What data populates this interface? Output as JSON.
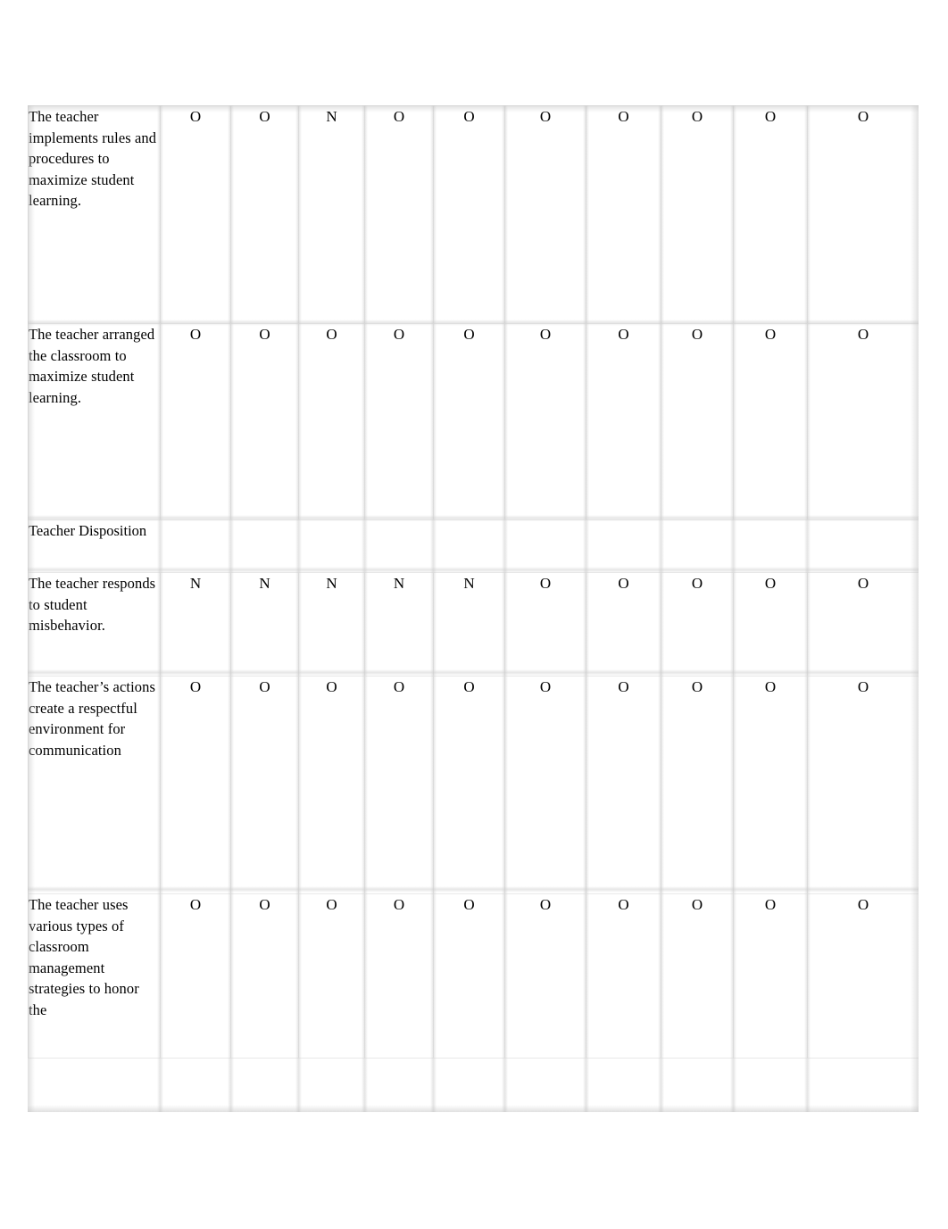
{
  "document": {
    "type": "rubric-table",
    "page_background": "#ffffff",
    "gridline_color": "#e9e9e9",
    "text_color": "#000000"
  },
  "table": {
    "column_count": 11,
    "rating_column_count": 10,
    "rows": [
      {
        "kind": "criterion",
        "label": "The teacher implements rules and procedures to maximize student learning.",
        "ratings": [
          "O",
          "O",
          "N",
          "O",
          "O",
          "O",
          "O",
          "O",
          "O",
          "O"
        ]
      },
      {
        "kind": "criterion",
        "label": "The teacher arranged the classroom to maximize student learning.",
        "ratings": [
          "O",
          "O",
          "O",
          "O",
          "O",
          "O",
          "O",
          "O",
          "O",
          "O"
        ]
      },
      {
        "kind": "section",
        "label": "Teacher Disposition",
        "ratings": []
      },
      {
        "kind": "criterion",
        "label": "The teacher responds to student misbehavior.",
        "ratings": [
          "N",
          "N",
          "N",
          "N",
          "N",
          "O",
          "O",
          "O",
          "O",
          "O"
        ]
      },
      {
        "kind": "criterion",
        "label": "The teacher’s actions create a respectful environment for communication",
        "ratings": [
          "O",
          "O",
          "O",
          "O",
          "O",
          "O",
          "O",
          "O",
          "O",
          "O"
        ]
      },
      {
        "kind": "criterion",
        "label": "The teacher uses various types of classroom management strategies to honor the",
        "ratings": [
          "O",
          "O",
          "O",
          "O",
          "O",
          "O",
          "O",
          "O",
          "O",
          "O"
        ]
      }
    ]
  }
}
